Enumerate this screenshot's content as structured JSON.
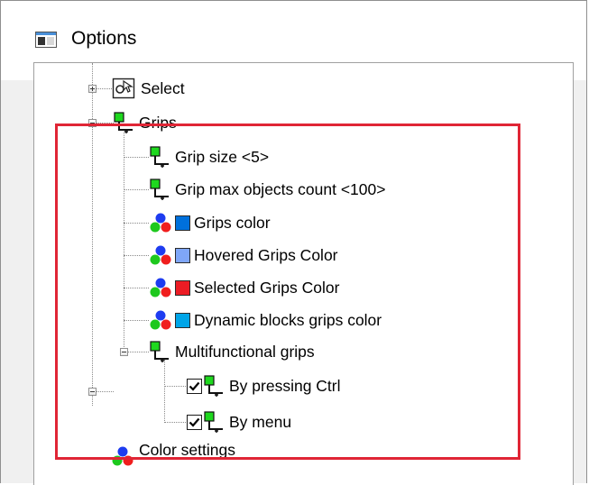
{
  "window": {
    "title": "Options"
  },
  "tree": {
    "select": {
      "label": "Select"
    },
    "grips": {
      "label": "Grips"
    },
    "grip_size": {
      "label": "Grip size <5>"
    },
    "grip_max": {
      "label": "Grip max objects count <100>"
    },
    "grips_color": {
      "label": "Grips color",
      "color": "#0070dc"
    },
    "hovered_color": {
      "label": "Hovered Grips Color",
      "color": "#7fa6f8"
    },
    "selected_color": {
      "label": "Selected Grips Color",
      "color": "#ec1c24"
    },
    "dynamic_color": {
      "label": "Dynamic blocks grips color",
      "color": "#00a5e8"
    },
    "multifunctional": {
      "label": "Multifunctional grips"
    },
    "by_ctrl": {
      "label": "By pressing Ctrl",
      "checked": true
    },
    "by_menu": {
      "label": "By menu",
      "checked": true
    },
    "color_settings": {
      "label": "Color settings"
    }
  },
  "icons": {
    "app": "options-window-icon",
    "select": "select-icon",
    "grip": "grip-icon",
    "color": "color-circles-icon"
  },
  "highlight_color": "#e02535"
}
